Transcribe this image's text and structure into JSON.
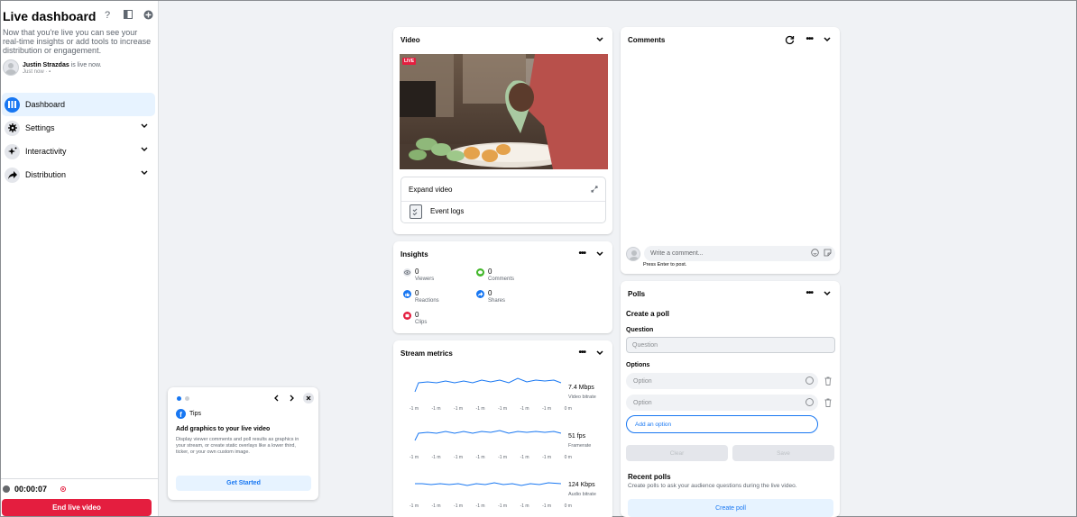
{
  "sidebar": {
    "title": "Live dashboard",
    "description": "Now that you're live you can see your real-time insights or add tools to increase distribution or engagement.",
    "user": {
      "name": "Justin Strazdas",
      "status": "is live now.",
      "time": "Just now"
    },
    "nav": [
      {
        "label": "Dashboard",
        "icon": "dashboard-icon",
        "active": true
      },
      {
        "label": "Settings",
        "icon": "gear-icon"
      },
      {
        "label": "Interactivity",
        "icon": "sparkle-icon"
      },
      {
        "label": "Distribution",
        "icon": "share-arrow-icon"
      }
    ],
    "timer": "00:00:07",
    "end_button": "End live video"
  },
  "tips": {
    "brand": "Tips",
    "title": "Add graphics to your live video",
    "body": "Display viewer comments and poll results as graphics in your stream, or create static overlays like a lower third, ticker, or your own custom image.",
    "button": "Get Started"
  },
  "video": {
    "title": "Video",
    "live_badge": "LIVE",
    "expand_label": "Expand video",
    "event_logs": "Event logs"
  },
  "insights": {
    "title": "Insights",
    "metrics": [
      {
        "value": "0",
        "label": "Viewers",
        "color": "#8a8d91"
      },
      {
        "value": "0",
        "label": "Comments",
        "color": "#42b72a"
      },
      {
        "value": "0",
        "label": "Reactions",
        "color": "#1877f2"
      },
      {
        "value": "0",
        "label": "Shares",
        "color": "#1877f2"
      },
      {
        "value": "0",
        "label": "Clips",
        "color": "#e41e3f"
      }
    ]
  },
  "stream": {
    "title": "Stream metrics",
    "ticks": [
      "-1 m",
      "-1 m",
      "-1 m",
      "-1 m",
      "-1 m",
      "-1 m",
      "-1 m",
      "0 m"
    ],
    "rows": [
      {
        "value": "7.4 Mbps",
        "label": "Video bitrate"
      },
      {
        "value": "51 fps",
        "label": "Framerate"
      },
      {
        "value": "124 Kbps",
        "label": "Audio bitrate"
      }
    ]
  },
  "comments": {
    "title": "Comments",
    "placeholder": "Write a comment...",
    "hint": "Press Enter to post."
  },
  "polls": {
    "title": "Polls",
    "create_heading": "Create a poll",
    "question_label": "Question",
    "question_placeholder": "Question",
    "options_label": "Options",
    "option_placeholders": [
      "Option",
      "Option"
    ],
    "add_option": "Add an option",
    "clear": "Clear",
    "save": "Save",
    "recent_heading": "Recent polls",
    "recent_desc": "Create polls to ask your audience questions during the live video.",
    "create_button": "Create poll"
  },
  "colors": {
    "accent": "#1877f2",
    "live_red": "#e41e3f",
    "background": "#f0f2f5"
  }
}
